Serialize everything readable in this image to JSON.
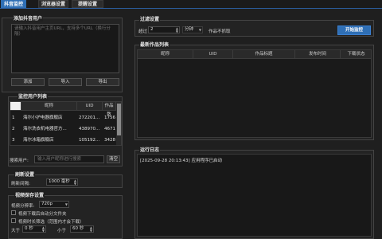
{
  "tabs": [
    {
      "label": "抖音监控"
    },
    {
      "label": "浏览器设置"
    },
    {
      "label": "提醒设置"
    }
  ],
  "add_users": {
    "title": "添加抖音用户",
    "placeholder": "请输入抖音用户主页URL，支持多个URL（换行分隔）",
    "add_label": "添加",
    "import_label": "导入",
    "export_label": "导出"
  },
  "monitor_list": {
    "title": "监控用户列表",
    "columns": [
      "昵称",
      "UID",
      "作品数"
    ],
    "rows": [
      {
        "index": "1",
        "nickname": "海尔小护电器旗舰店",
        "uid": "272201...",
        "works": "1756"
      },
      {
        "index": "2",
        "nickname": "海尔洗衣机电器官方...",
        "uid": "438970...",
        "works": "4671"
      },
      {
        "index": "3",
        "nickname": "海尔冰箱旗舰店",
        "uid": "105192...",
        "works": "3428"
      }
    ],
    "search_label": "搜索用户:",
    "search_placeholder": "输入用户昵称进行搜索",
    "clear_label": "清空"
  },
  "refresh": {
    "title": "刷新设置",
    "interval_label": "刷新间隔:",
    "interval_value": "1000 毫秒"
  },
  "video": {
    "title": "视频保存设置",
    "quality_label": "视频分辨率:",
    "quality_value": "720p",
    "opt1": "视频下载后自动分文件夹",
    "opt2": "视频时长筛选（范围内才会下载）",
    "gt_label": "大于",
    "gt_value": "0 秒",
    "lt_label": "小于",
    "lt_value": "60 秒"
  },
  "filter": {
    "title": "过滤设置",
    "exceed_label": "超过",
    "exceed_value": "2",
    "unit_value": "分钟",
    "suffix": "作品不抓取",
    "start_label": "开始监控"
  },
  "latest": {
    "title": "最新作品列表",
    "columns": [
      "昵称",
      "UID",
      "作品标题",
      "发布时间",
      "下载状态"
    ]
  },
  "log": {
    "title": "运行日志",
    "lines": [
      "[2025-09-28 20:13:43] 应用程序已启动"
    ]
  },
  "colors": {
    "accent": "#2f6fb5",
    "background": "#1f1f1f"
  }
}
